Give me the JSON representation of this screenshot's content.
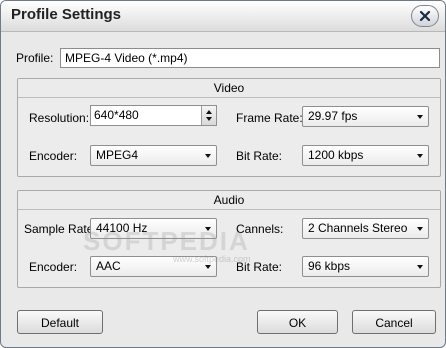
{
  "window": {
    "title": "Profile Settings"
  },
  "profile": {
    "label": "Profile:",
    "value": "MPEG-4 Video (*.mp4)"
  },
  "video": {
    "heading": "Video",
    "resolution_label": "Resolution:",
    "resolution_value": "640*480",
    "frame_rate_label": "Frame Rate:",
    "frame_rate_value": "29.97 fps",
    "encoder_label": "Encoder:",
    "encoder_value": "MPEG4",
    "bit_rate_label": "Bit Rate:",
    "bit_rate_value": "1200 kbps"
  },
  "audio": {
    "heading": "Audio",
    "sample_rate_label": "Sample Rate:",
    "sample_rate_value": "44100 Hz",
    "channels_label": "Cannels:",
    "channels_value": "2 Channels Stereo",
    "encoder_label": "Encoder:",
    "encoder_value": "AAC",
    "bit_rate_label": "Bit Rate:",
    "bit_rate_value": "96 kbps"
  },
  "buttons": {
    "default": "Default",
    "ok": "OK",
    "cancel": "Cancel"
  },
  "watermark": {
    "text": "SOFTPEDIA",
    "url": "www.softpedia.com"
  }
}
